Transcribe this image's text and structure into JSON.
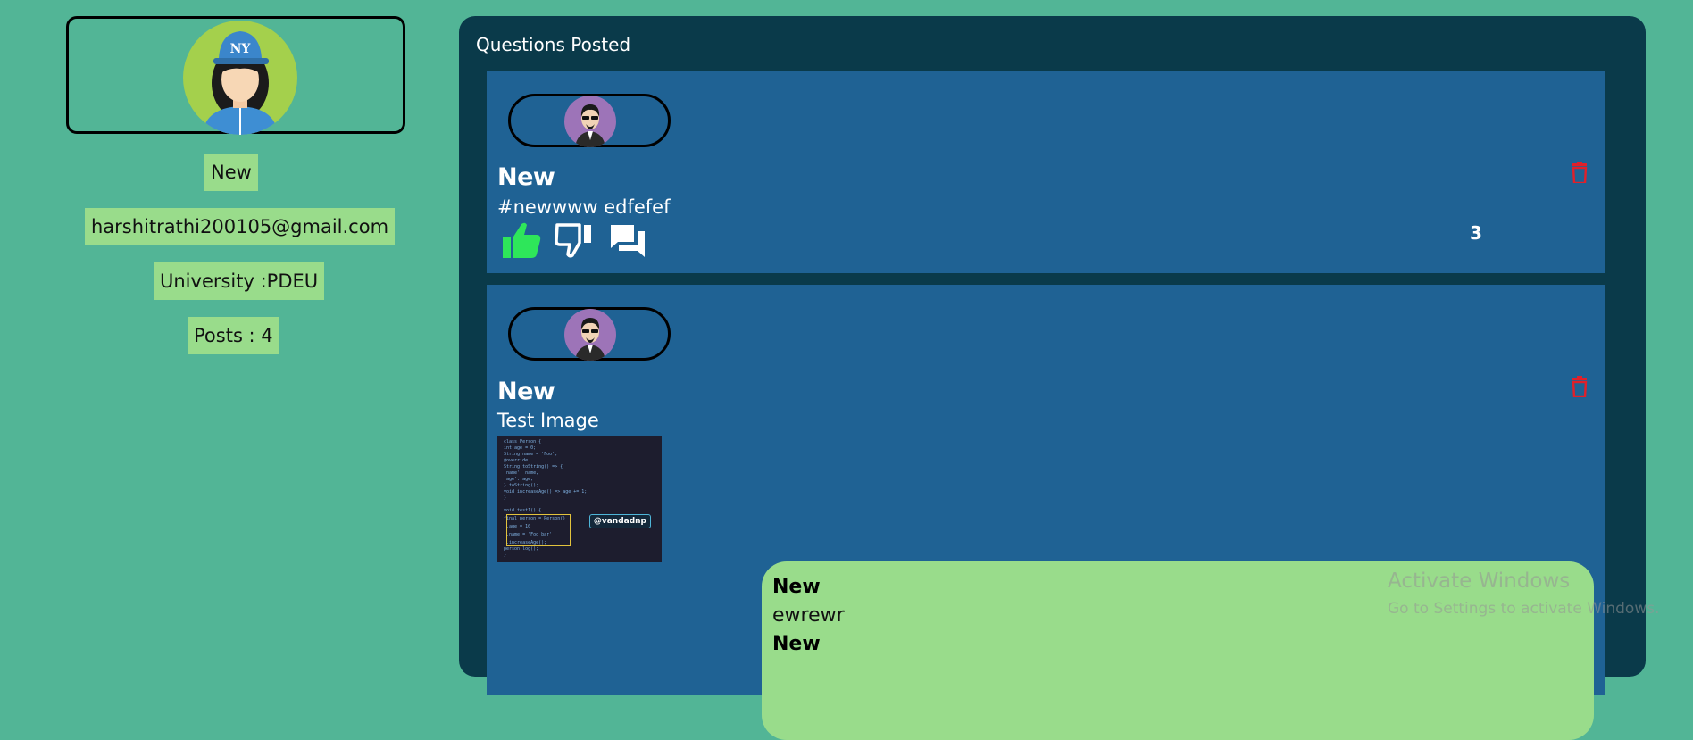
{
  "profile": {
    "name": "New",
    "email": "harshitrathi200105@gmail.com",
    "university": "University :PDEU",
    "posts": "Posts : 4",
    "avatar_cap_text": "NY"
  },
  "questions": {
    "title": "Questions Posted",
    "items": [
      {
        "author": "New",
        "body": "#newwww edfefef",
        "comment_count": "3"
      },
      {
        "author": "New",
        "body": "Test Image",
        "image_tag": "@vandadnp",
        "code_lines": [
          "class Person {",
          "  int age = 0;",
          "  String name = 'Foo';",
          "  @override",
          "  String toString() => {",
          "        'name': name,",
          "        'age': age,",
          "      }.toString();",
          "  void increaseAge() => age += 1;",
          "}",
          "",
          "void test1() {",
          "  final person = Person()",
          "    ..age = 10",
          "    ..name = 'Foo bar'",
          "    ..increaseAge();",
          "  person.log();",
          "}"
        ],
        "comments": [
          {
            "author": "New",
            "text": "ewrewr"
          },
          {
            "author": "New",
            "text": ""
          }
        ]
      }
    ]
  },
  "watermark": {
    "line1": "Activate Windows",
    "line2": "Go to Settings to activate Windows."
  },
  "colors": {
    "page_bg": "#52b596",
    "panel_bg": "#0a3a4a",
    "post_bg": "#1f6294",
    "chip_bg": "#99dc8b",
    "like_active": "#2ee65a",
    "delete": "#e0202a"
  },
  "icons": [
    "avatar-icon",
    "thumbs-up-icon",
    "thumbs-down-icon",
    "comment-icon",
    "trash-icon"
  ]
}
